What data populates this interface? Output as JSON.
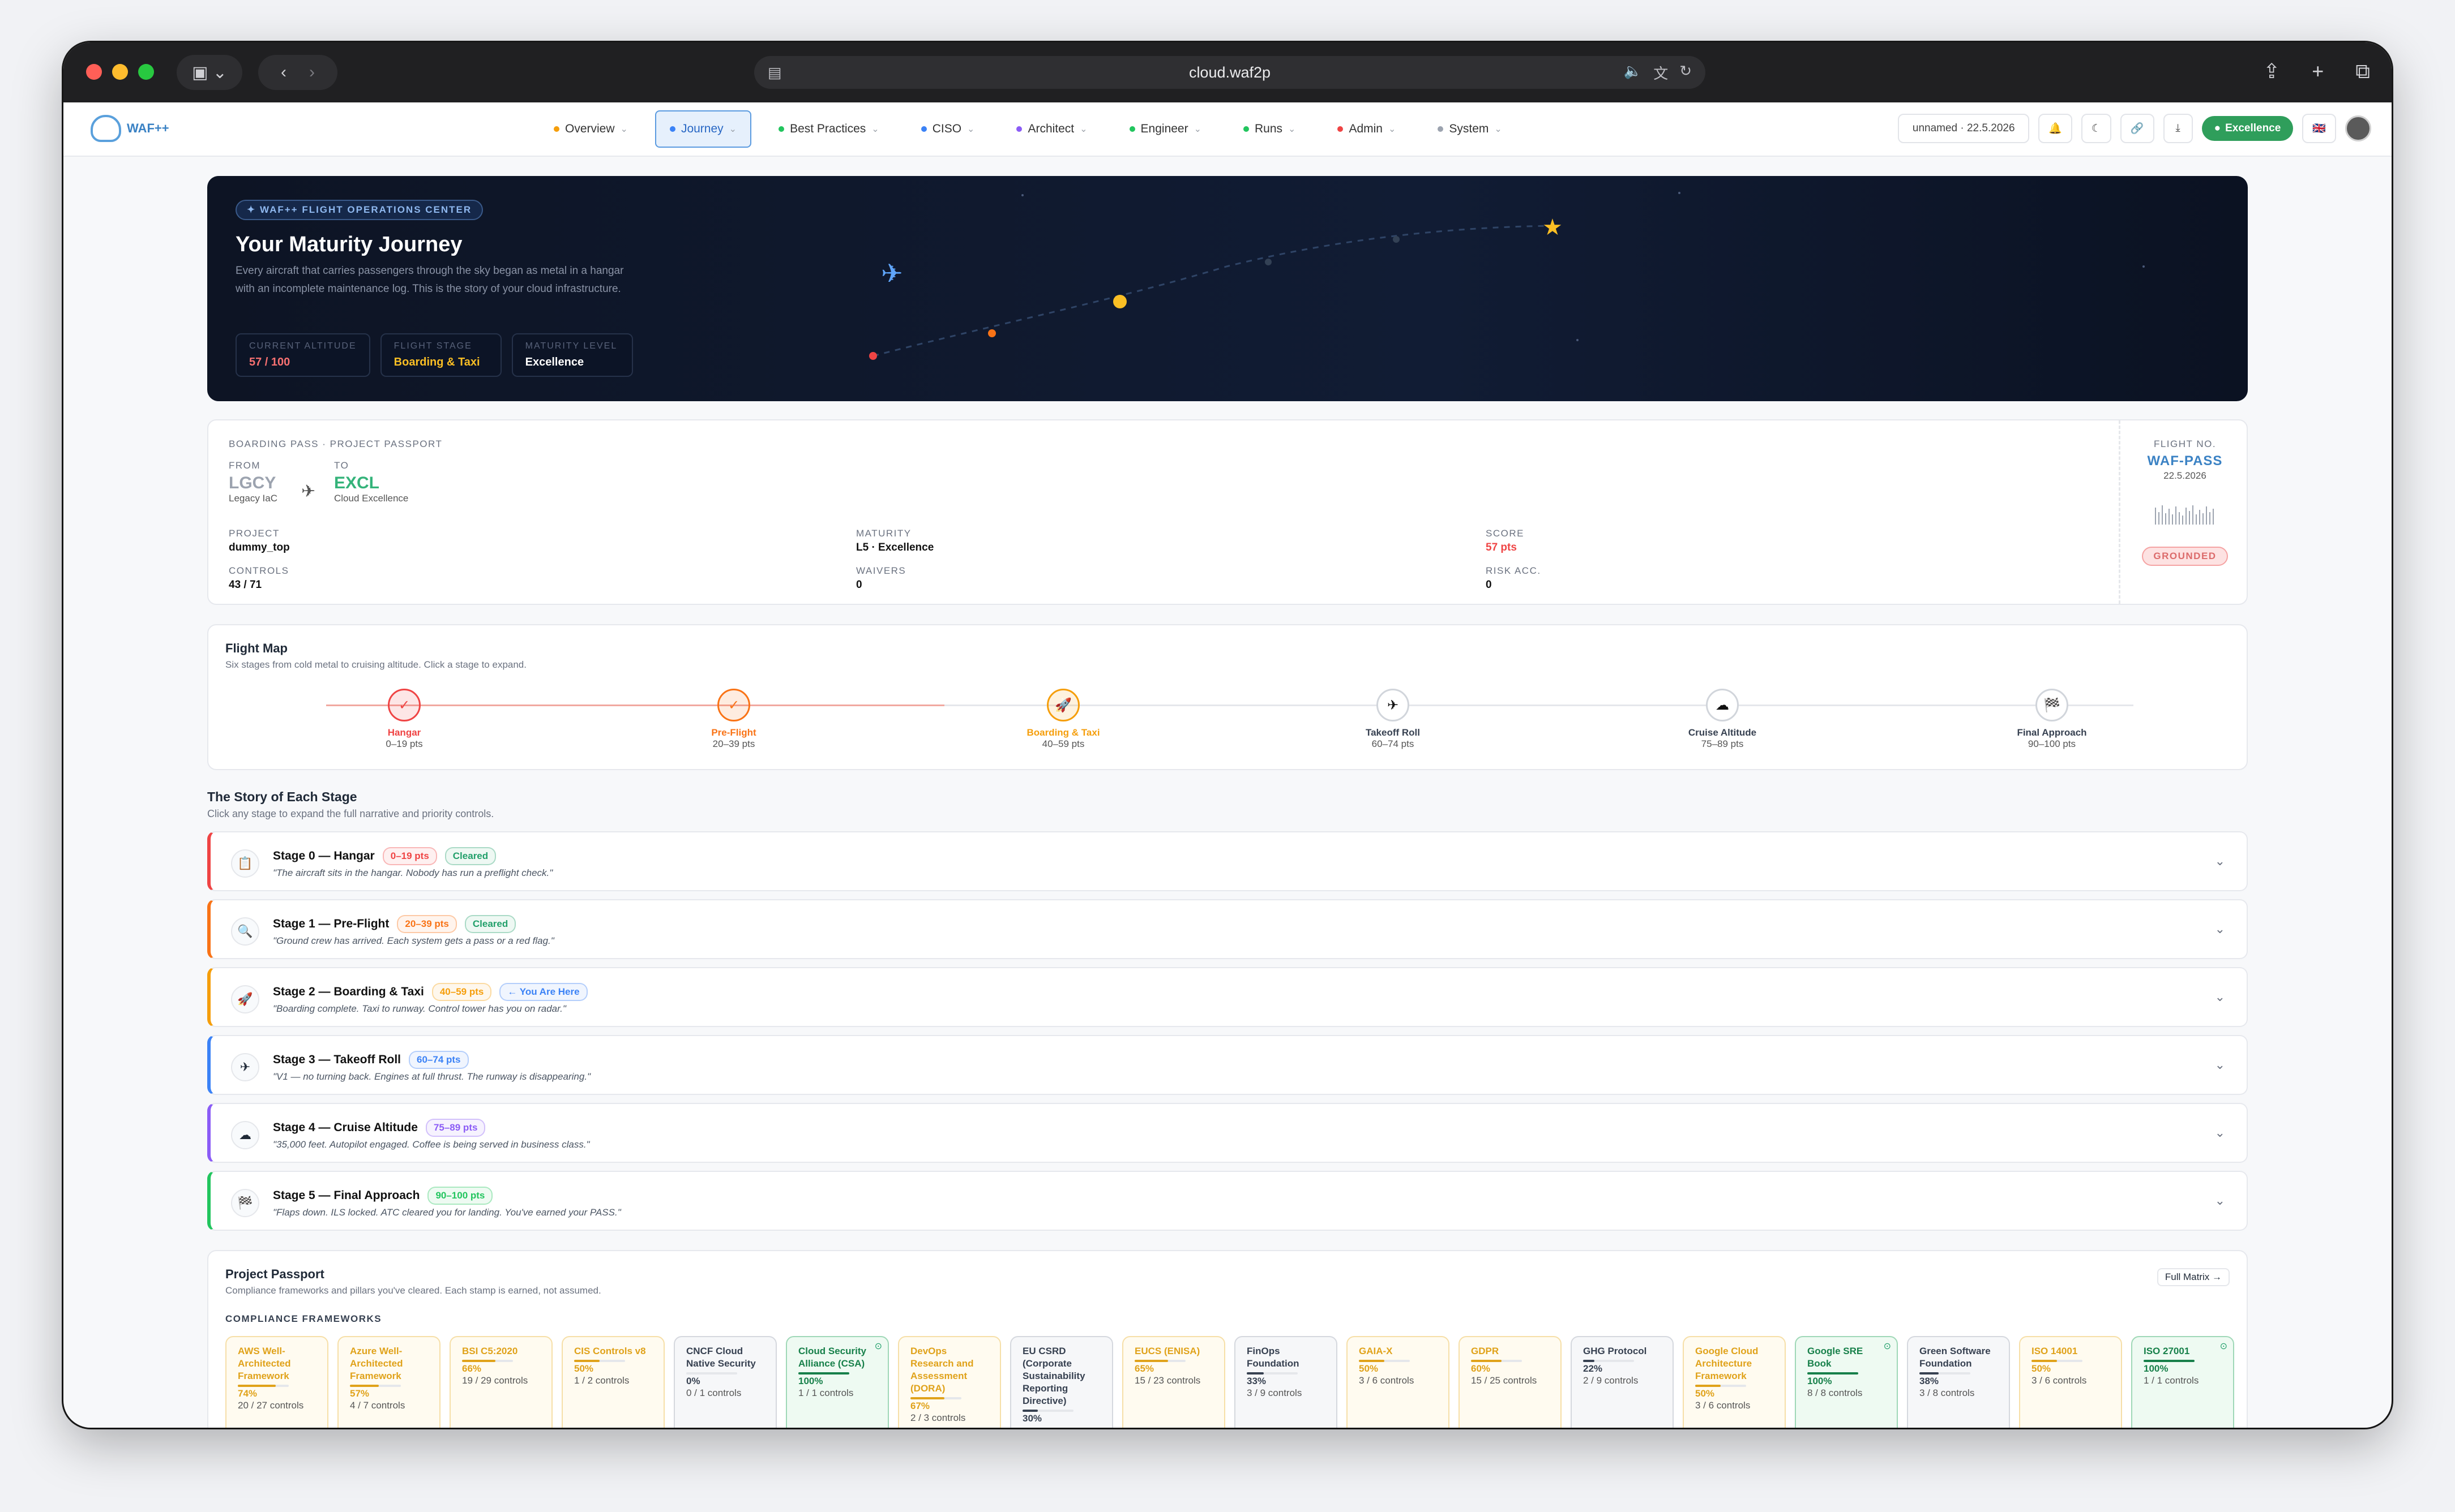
{
  "browser": {
    "url": "cloud.waf2p"
  },
  "app": {
    "logo_text": "WAF++"
  },
  "nav": [
    {
      "label": "Overview",
      "color": "#f59e0b"
    },
    {
      "label": "Journey",
      "color": "#3b82f6",
      "active": true
    },
    {
      "label": "Best Practices",
      "color": "#22c55e"
    },
    {
      "label": "CISO",
      "color": "#3b82f6"
    },
    {
      "label": "Architect",
      "color": "#8b5cf6"
    },
    {
      "label": "Engineer",
      "color": "#22c55e"
    },
    {
      "label": "Runs",
      "color": "#22c55e"
    },
    {
      "label": "Admin",
      "color": "#ef4444"
    },
    {
      "label": "System",
      "color": "#9ca3af"
    }
  ],
  "header_controls": {
    "run_select": "unnamed · 22.5.2026",
    "level_badge": "Excellence",
    "flag": "🇬🇧"
  },
  "hero": {
    "pill": "✦ WAF++ FLIGHT OPERATIONS CENTER",
    "title": "Your Maturity Journey",
    "description": "Every aircraft that carries passengers through the sky began as metal in a hangar with an incomplete maintenance log. This is the story of your cloud infrastructure.",
    "stats": [
      {
        "label": "CURRENT ALTITUDE",
        "value": "57 / 100",
        "color": "#f87171"
      },
      {
        "label": "FLIGHT STAGE",
        "value": "Boarding & Taxi",
        "color": "#fbbf24"
      },
      {
        "label": "MATURITY LEVEL",
        "value": "Excellence",
        "color": "#ffffff"
      }
    ]
  },
  "boarding_pass": {
    "heading": "BOARDING PASS · PROJECT PASSPORT",
    "from_label": "FROM",
    "from_code": "LGCY",
    "from_name": "Legacy IaC",
    "to_label": "TO",
    "to_code": "EXCL",
    "to_name": "Cloud Excellence",
    "fields": [
      {
        "label": "PROJECT",
        "value": "dummy_top"
      },
      {
        "label": "MATURITY",
        "value": "L5 · Excellence"
      },
      {
        "label": "SCORE",
        "value": "57 pts"
      },
      {
        "label": "CONTROLS",
        "value": "43 / 71"
      },
      {
        "label": "WAIVERS",
        "value": "0"
      },
      {
        "label": "RISK ACC.",
        "value": "0"
      }
    ],
    "flight_no_label": "FLIGHT NO.",
    "flight_no": "WAF-PASS",
    "date": "22.5.2026",
    "status": "GROUNDED"
  },
  "flight_map": {
    "title": "Flight Map",
    "subtitle": "Six stages from cold metal to cruising altitude. Click a stage to expand.",
    "stages": [
      {
        "name": "Hangar",
        "range": "0–19 pts",
        "icon": "✓",
        "color": "#ef4444"
      },
      {
        "name": "Pre-Flight",
        "range": "20–39 pts",
        "icon": "✓",
        "color": "#f97316"
      },
      {
        "name": "Boarding & Taxi",
        "range": "40–59 pts",
        "icon": "🚀",
        "color": "#f59e0b"
      },
      {
        "name": "Takeoff Roll",
        "range": "60–74 pts",
        "icon": "✈",
        "color": "#111"
      },
      {
        "name": "Cruise Altitude",
        "range": "75–89 pts",
        "icon": "☁",
        "color": "#111"
      },
      {
        "name": "Final Approach",
        "range": "90–100 pts",
        "icon": "🏁",
        "color": "#111"
      }
    ]
  },
  "story": {
    "title": "The Story of Each Stage",
    "subtitle": "Click any stage to expand the full narrative and priority controls.",
    "stages": [
      {
        "name": "Stage 0 — Hangar",
        "pts": "0–19 pts",
        "status": "Cleared",
        "quote": "\"The aircraft sits in the hangar. Nobody has run a preflight check.\"",
        "icon": "📋",
        "color": "#ef4444"
      },
      {
        "name": "Stage 1 — Pre-Flight",
        "pts": "20–39 pts",
        "status": "Cleared",
        "quote": "\"Ground crew has arrived. Each system gets a pass or a red flag.\"",
        "icon": "🔍",
        "color": "#f97316"
      },
      {
        "name": "Stage 2 — Boarding & Taxi",
        "pts": "40–59 pts",
        "status": "← You Are Here",
        "quote": "\"Boarding complete. Taxi to runway. Control tower has you on radar.\"",
        "icon": "🚀",
        "color": "#f59e0b"
      },
      {
        "name": "Stage 3 — Takeoff Roll",
        "pts": "60–74 pts",
        "status": "",
        "quote": "\"V1 — no turning back. Engines at full thrust. The runway is disappearing.\"",
        "icon": "✈",
        "color": "#3b82f6"
      },
      {
        "name": "Stage 4 — Cruise Altitude",
        "pts": "75–89 pts",
        "status": "",
        "quote": "\"35,000 feet. Autopilot engaged. Coffee is being served in business class.\"",
        "icon": "☁",
        "color": "#8b5cf6"
      },
      {
        "name": "Stage 5 — Final Approach",
        "pts": "90–100 pts",
        "status": "",
        "quote": "\"Flaps down. ILS locked. ATC cleared you for landing. You've earned your PASS.\"",
        "icon": "🏁",
        "color": "#22c55e"
      }
    ]
  },
  "passport": {
    "title": "Project Passport",
    "subtitle": "Compliance frameworks and pillars you've cleared. Each stamp is earned, not assumed.",
    "full_matrix": "Full Matrix →",
    "section": "COMPLIANCE FRAMEWORKS",
    "frameworks": [
      {
        "name": "AWS Well-Architected Framework",
        "pct": "74%",
        "controls": "20 / 27 controls",
        "fill": 0.74,
        "tone": "amber"
      },
      {
        "name": "Azure Well-Architected Framework",
        "pct": "57%",
        "controls": "4 / 7 controls",
        "fill": 0.57,
        "tone": "amber"
      },
      {
        "name": "BSI C5:2020",
        "pct": "66%",
        "controls": "19 / 29 controls",
        "fill": 0.66,
        "tone": "amber"
      },
      {
        "name": "CIS Controls v8",
        "pct": "50%",
        "controls": "1 / 2 controls",
        "fill": 0.5,
        "tone": "amber"
      },
      {
        "name": "CNCF Cloud Native Security",
        "pct": "0%",
        "controls": "0 / 1 controls",
        "fill": 0,
        "tone": "gray"
      },
      {
        "name": "Cloud Security Alliance (CSA)",
        "pct": "100%",
        "controls": "1 / 1 controls",
        "fill": 1,
        "tone": "green"
      },
      {
        "name": "DevOps Research and Assessment (DORA)",
        "pct": "67%",
        "controls": "2 / 3 controls",
        "fill": 0.67,
        "tone": "amber"
      },
      {
        "name": "EU CSRD (Corporate Sustainability Reporting Directive)",
        "pct": "30%",
        "controls": "",
        "fill": 0.3,
        "tone": "gray"
      },
      {
        "name": "EUCS (ENISA)",
        "pct": "65%",
        "controls": "15 / 23 controls",
        "fill": 0.65,
        "tone": "amber"
      },
      {
        "name": "FinOps Foundation",
        "pct": "33%",
        "controls": "3 / 9 controls",
        "fill": 0.33,
        "tone": "gray"
      },
      {
        "name": "GAIA-X",
        "pct": "50%",
        "controls": "3 / 6 controls",
        "fill": 0.5,
        "tone": "amber"
      },
      {
        "name": "GDPR",
        "pct": "60%",
        "controls": "15 / 25 controls",
        "fill": 0.6,
        "tone": "amber"
      },
      {
        "name": "GHG Protocol",
        "pct": "22%",
        "controls": "2 / 9 controls",
        "fill": 0.22,
        "tone": "gray"
      },
      {
        "name": "Google Cloud Architecture Framework",
        "pct": "50%",
        "controls": "3 / 6 controls",
        "fill": 0.5,
        "tone": "amber"
      },
      {
        "name": "Google SRE Book",
        "pct": "100%",
        "controls": "8 / 8 controls",
        "fill": 1,
        "tone": "green"
      },
      {
        "name": "Green Software Foundation",
        "pct": "38%",
        "controls": "3 / 8 controls",
        "fill": 0.38,
        "tone": "gray"
      },
      {
        "name": "ISO 14001",
        "pct": "50%",
        "controls": "3 / 6 controls",
        "fill": 0.5,
        "tone": "amber"
      },
      {
        "name": "ISO 27001",
        "pct": "100%",
        "controls": "1 / 1 controls",
        "fill": 1,
        "tone": "green"
      }
    ]
  }
}
